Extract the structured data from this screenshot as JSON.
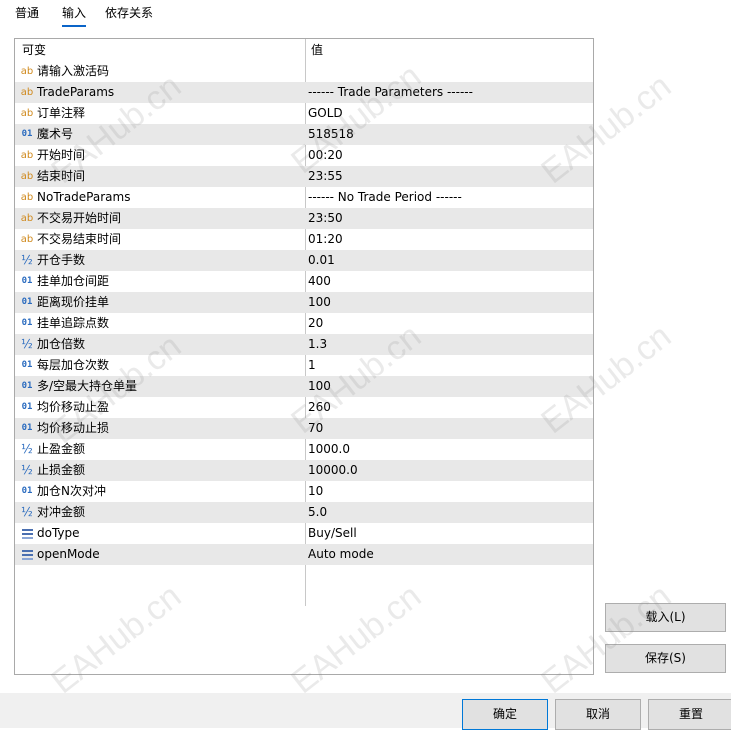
{
  "tabs": [
    {
      "label": "普通"
    },
    {
      "label": "输入"
    },
    {
      "label": "依存关系"
    }
  ],
  "grid": {
    "header": {
      "variable": "可变",
      "value": "值"
    },
    "rows": [
      {
        "icon": "ab",
        "name": "请输入激活码",
        "value": ""
      },
      {
        "icon": "ab",
        "name": "TradeParams",
        "value": "------ Trade Parameters ------"
      },
      {
        "icon": "ab",
        "name": "订单注释",
        "value": "GOLD"
      },
      {
        "icon": "01",
        "name": "魔术号",
        "value": "518518"
      },
      {
        "icon": "ab",
        "name": "开始时间",
        "value": "00:20"
      },
      {
        "icon": "ab",
        "name": "结束时间",
        "value": "23:55"
      },
      {
        "icon": "ab",
        "name": "NoTradeParams",
        "value": "------ No Trade Period ------"
      },
      {
        "icon": "ab",
        "name": "不交易开始时间",
        "value": "23:50"
      },
      {
        "icon": "ab",
        "name": "不交易结束时间",
        "value": "01:20"
      },
      {
        "icon": "½",
        "name": "开仓手数",
        "value": "0.01"
      },
      {
        "icon": "01",
        "name": "挂单加仓间距",
        "value": "400"
      },
      {
        "icon": "01",
        "name": "距离现价挂单",
        "value": "100"
      },
      {
        "icon": "01",
        "name": "挂单追踪点数",
        "value": "20"
      },
      {
        "icon": "½",
        "name": "加仓倍数",
        "value": "1.3"
      },
      {
        "icon": "01",
        "name": "每层加仓次数",
        "value": "1"
      },
      {
        "icon": "01",
        "name": "多/空最大持仓单量",
        "value": "100"
      },
      {
        "icon": "01",
        "name": "均价移动止盈",
        "value": "260"
      },
      {
        "icon": "01",
        "name": "均价移动止损",
        "value": "70"
      },
      {
        "icon": "½",
        "name": "止盈金额",
        "value": "1000.0"
      },
      {
        "icon": "½",
        "name": "止损金额",
        "value": "10000.0"
      },
      {
        "icon": "01",
        "name": "加仓N次对冲",
        "value": "10"
      },
      {
        "icon": "½",
        "name": "对冲金额",
        "value": "5.0"
      },
      {
        "icon": "list-icon",
        "name": "doType",
        "value": "Buy/Sell"
      },
      {
        "icon": "list-icon",
        "name": "openMode",
        "value": "Auto mode"
      }
    ]
  },
  "buttons": {
    "load": "载入(L)",
    "save": "保存(S)",
    "ok": "确定",
    "cancel": "取消",
    "reset": "重置"
  },
  "watermark": "EAHub.cn",
  "colors": {
    "accent": "#0a64c8",
    "alt_row": "#e8e8e8",
    "icon_string": "#d08a1e",
    "icon_number": "#2a6bbf"
  }
}
